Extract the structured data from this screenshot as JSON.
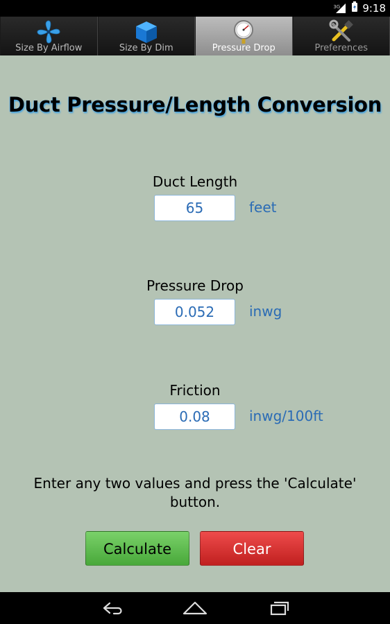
{
  "status_bar": {
    "time": "9:18",
    "network": "3G"
  },
  "tabs": [
    {
      "label": "Size By Airflow",
      "icon": "fan-icon",
      "active": false
    },
    {
      "label": "Size By Dim",
      "icon": "cube-icon",
      "active": false
    },
    {
      "label": "Pressure Drop",
      "icon": "pressure-gauge-icon",
      "active": true
    },
    {
      "label": "Preferences",
      "icon": "tools-icon",
      "active": false
    }
  ],
  "page": {
    "title": "Duct Pressure/Length Conversion",
    "fields": {
      "duct_length": {
        "label": "Duct Length",
        "value": "65",
        "unit": "feet"
      },
      "pressure_drop": {
        "label": "Pressure Drop",
        "value": "0.052",
        "unit": "inwg"
      },
      "friction": {
        "label": "Friction",
        "value": "0.08",
        "unit": "inwg/100ft"
      }
    },
    "instructions": "Enter any two values and press the 'Calculate' button.",
    "buttons": {
      "calculate": "Calculate",
      "clear": "Clear"
    }
  },
  "colors": {
    "background": "#b4c3b4",
    "accent_blue": "#2a6bb5",
    "calculate_green": "#5fbf4f",
    "clear_red": "#d93232"
  },
  "nav": {
    "back": "back-icon",
    "home": "home-icon",
    "recents": "recent-apps-icon"
  }
}
